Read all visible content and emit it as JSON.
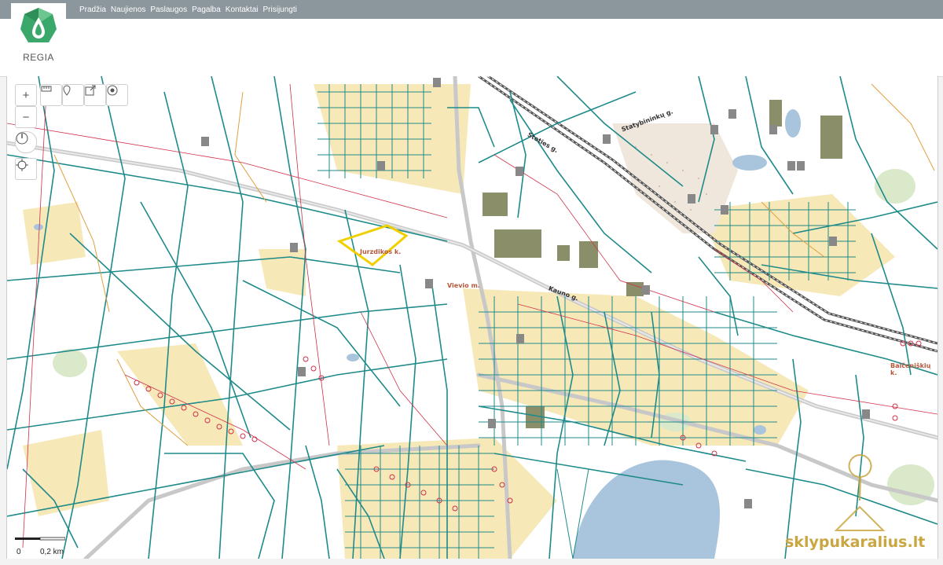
{
  "nav": {
    "items": [
      "Pradžia",
      "Naujienos",
      "Paslaugos",
      "Pagalba",
      "Kontaktai",
      "Prisijungti"
    ]
  },
  "logo": {
    "text": "REGIA"
  },
  "colors": {
    "topbar": "#8c969d",
    "parcel_line": "#1f8a8a",
    "road": "#c8c8c8",
    "highlight": "#f0d000",
    "water": "#a9c4dd",
    "yellow_area": "#f6e6b0",
    "power": "#d0314a",
    "brand": "#c9a640"
  },
  "controls": {
    "zoom_in": "+",
    "zoom_out": "−",
    "tools": [
      "ruler-icon",
      "marker-icon",
      "export-icon",
      "locate-icon"
    ],
    "side": [
      "compass-icon",
      "target-icon"
    ]
  },
  "map": {
    "labels": [
      "Jurzdikos k.",
      "Vievio m.",
      "Kauno g.",
      "Balčeniškių k.",
      "Stoties g.",
      "Statybininkų g."
    ]
  },
  "scale": {
    "start": "0",
    "end": "0,2 km"
  },
  "brand": {
    "text": "sklypukaralius.lt"
  }
}
